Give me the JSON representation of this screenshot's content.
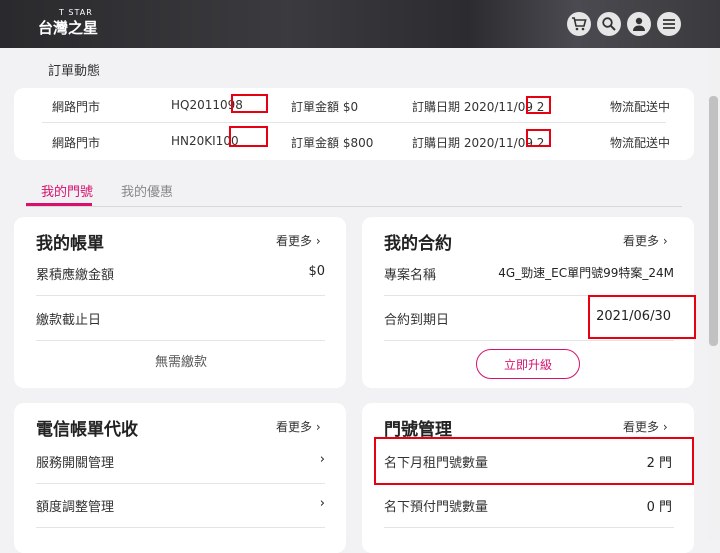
{
  "header": {
    "logo_small": "T STAR",
    "logo_big": "台灣之星",
    "icons": [
      "cart-icon",
      "search-icon",
      "user-icon",
      "menu-icon"
    ]
  },
  "orders": {
    "title": "訂單動態",
    "rows": [
      {
        "store": "網路門市",
        "order_no": "HQ2011098",
        "amount": "訂單金額 $0",
        "date": "訂購日期 2020/11/09 2",
        "status": "物流配送中"
      },
      {
        "store": "網路門市",
        "order_no": "HN20KI100",
        "amount": "訂單金額 $800",
        "date": "訂購日期 2020/11/09 2",
        "status": "物流配送中"
      }
    ]
  },
  "tabs": {
    "my_number": "我的門號",
    "my_offers": "我的優惠"
  },
  "bill": {
    "title": "我的帳單",
    "more": "看更多",
    "rows": [
      {
        "label": "累積應繳金額",
        "value": "$0"
      },
      {
        "label": "繳款截止日",
        "value": ""
      }
    ],
    "note": "無需繳款"
  },
  "contract": {
    "title": "我的合約",
    "more": "看更多",
    "rows": [
      {
        "label": "專案名稱",
        "value": "4G_勁速_EC單門號99特案_24M"
      },
      {
        "label": "合約到期日",
        "value": "2021/06/30"
      }
    ],
    "upgrade": "立即升級"
  },
  "telecom": {
    "title": "電信帳單代收",
    "more": "看更多",
    "rows": [
      {
        "label": "服務開關管理"
      },
      {
        "label": "額度調整管理"
      }
    ]
  },
  "numbers": {
    "title": "門號管理",
    "more": "看更多",
    "rows": [
      {
        "label": "名下月租門號數量",
        "value": "2 門"
      },
      {
        "label": "名下預付門號數量",
        "value": "0 門"
      }
    ]
  },
  "colors": {
    "accent": "#d6126e",
    "highlight": "#e60012"
  }
}
